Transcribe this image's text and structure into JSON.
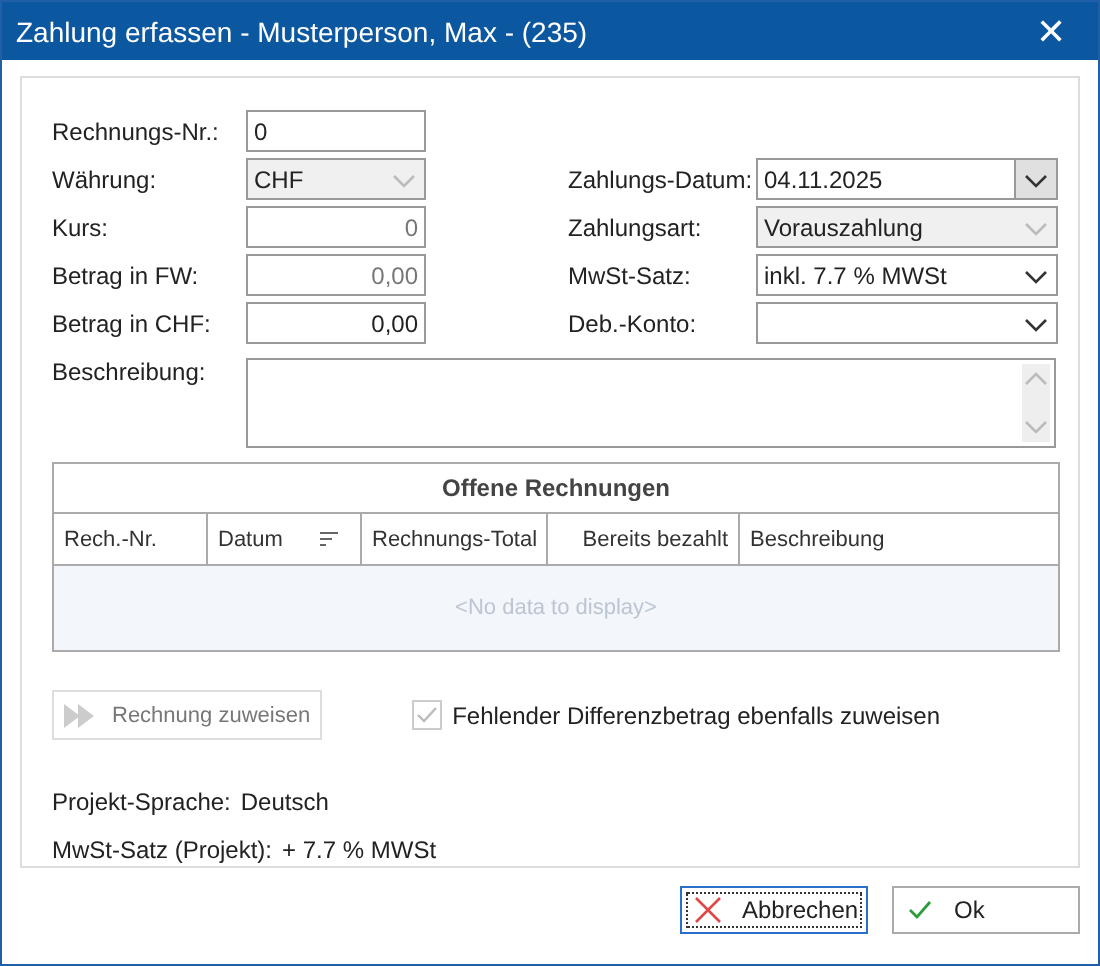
{
  "window": {
    "title": "Zahlung erfassen - Musterperson, Max - (235)",
    "close": "✕"
  },
  "left_fields": [
    {
      "label": "Rechnungs-Nr.:",
      "value": "0",
      "kind": "text",
      "disabled": false
    },
    {
      "label": "Währung:",
      "value": "CHF",
      "kind": "combo",
      "disabled": true
    },
    {
      "label": "Kurs:",
      "value": "0",
      "kind": "number",
      "disabled": true
    },
    {
      "label": "Betrag in FW:",
      "value": "0,00",
      "kind": "number",
      "disabled": true
    },
    {
      "label": "Betrag in CHF:",
      "value": "0,00",
      "kind": "number",
      "disabled": false
    }
  ],
  "right_fields": [
    {
      "label": "Zahlungs-Datum:",
      "value": "04.11.2025",
      "kind": "date",
      "disabled": false
    },
    {
      "label": "Zahlungsart:",
      "value": "Vorauszahlung",
      "kind": "combo",
      "disabled": true
    },
    {
      "label": "MwSt-Satz:",
      "value": "inkl. 7.7 % MWSt",
      "kind": "combo",
      "disabled": false
    },
    {
      "label": "Deb.-Konto:",
      "kind": "combo",
      "disabled": false
    }
  ],
  "description": {
    "label": "Beschreibung:"
  },
  "grid": {
    "title": "Offene Rechnungen",
    "columns": [
      {
        "label": "Rech.-Nr.",
        "sorted": false
      },
      {
        "label": "Datum",
        "sorted": true
      },
      {
        "label": "Rechnungs-Total",
        "sorted": false
      },
      {
        "label": "Bereits bezahlt",
        "sorted": false
      },
      {
        "label": "Beschreibung",
        "sorted": false
      }
    ],
    "empty_text": "<No data to display>"
  },
  "assign_button": {
    "label": "Rechnung zuweisen",
    "disabled": true
  },
  "assign_difference": {
    "label": "Fehlender Differenzbetrag ebenfalls zuweisen",
    "checked": true,
    "disabled": true
  },
  "info": [
    {
      "label": "Projekt-Sprache:",
      "value": "Deutsch"
    },
    {
      "label": "MwSt-Satz (Projekt):",
      "value": "+ 7.7 % MWSt"
    }
  ],
  "buttons": [
    {
      "label": "Abbrechen",
      "kind": "cancel",
      "focused": true
    },
    {
      "label": "Ok",
      "kind": "ok",
      "focused": false
    }
  ]
}
